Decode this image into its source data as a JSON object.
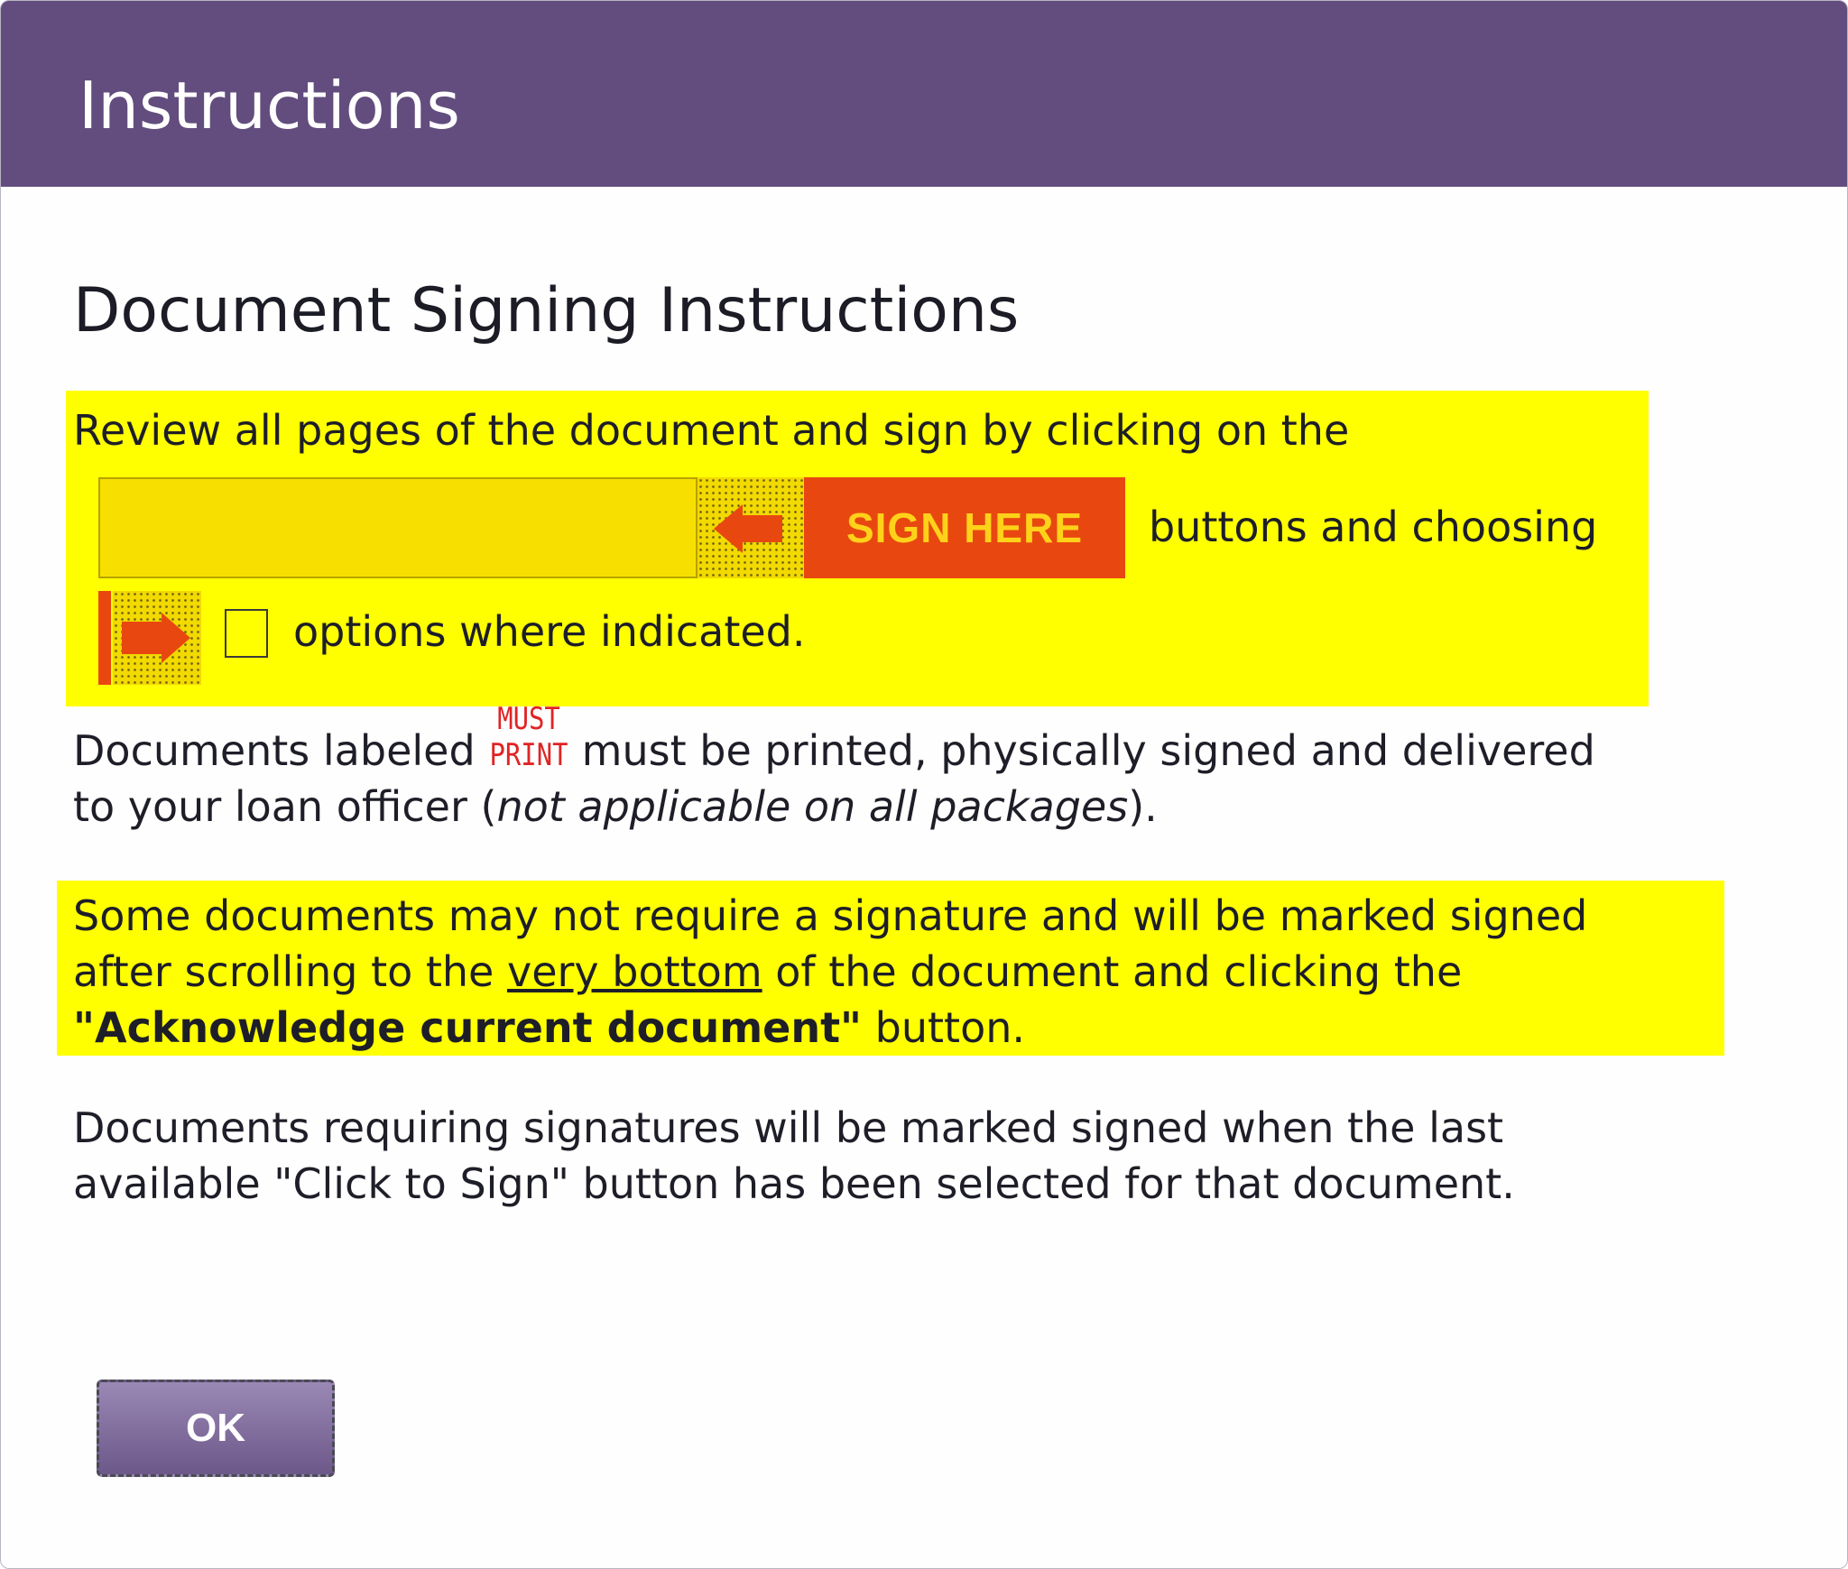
{
  "dialog": {
    "title": "Instructions",
    "heading": "Document Signing Instructions"
  },
  "step1": {
    "line1": "Review all pages of the document and sign by clicking on the",
    "sign_button_label": "SIGN HERE",
    "line2": "buttons and choosing",
    "line3": "options where indicated."
  },
  "step2": {
    "text_before": "Documents labeled",
    "badge_word1": "MUST",
    "badge_word2": "PRINT",
    "text_after": "must be printed, physically signed and delivered",
    "line2_start": "to your loan officer (",
    "line2_italic": "not applicable on all packages",
    "line2_end": ")."
  },
  "step3": {
    "line1": "Some documents may not require a signature and will be marked signed",
    "line2_before": "after scrolling to the ",
    "line2_underline": "very bottom",
    "line2_after": " of the document and clicking the",
    "line3_bold": "\"Acknowledge current document\"",
    "line3_after": " button."
  },
  "step4": {
    "line1": "Documents requiring signatures will be marked signed when the last",
    "line2": "available \"Click to Sign\" button has been selected for that document."
  },
  "buttons": {
    "ok_label": "OK"
  },
  "colors": {
    "titlebar": "#624d7e",
    "highlight": "#ffff00",
    "sign_button": "#e84810",
    "sign_text": "#ffd21a",
    "must_print": "#e02424"
  },
  "icons": {
    "sign_tab": "left-arrow-icon",
    "option_tab": "right-arrow-icon"
  }
}
